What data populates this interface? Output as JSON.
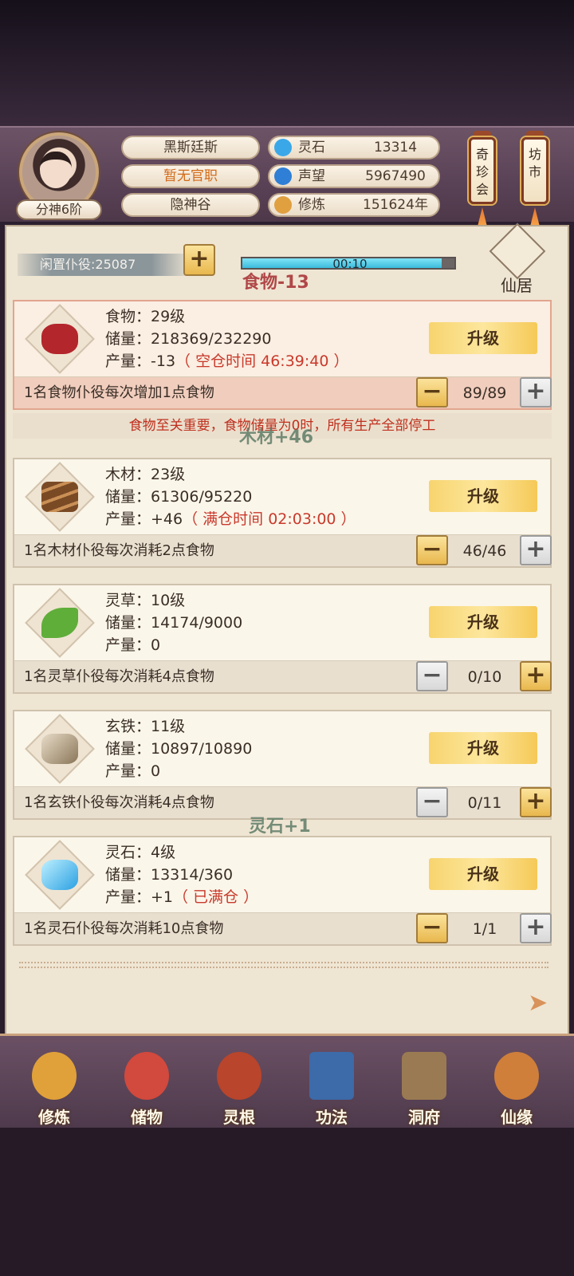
{
  "header": {
    "rank_badge": "分神6阶",
    "player_name": "黑斯廷斯",
    "official_title": "暂无官职",
    "location": "隐神谷",
    "resources": [
      {
        "label": "灵石",
        "value": "13314",
        "icon": "spirit-stone-icon",
        "color": "#3aa8e8"
      },
      {
        "label": "声望",
        "value": "5967490",
        "icon": "prestige-icon",
        "color": "#2f7fd6"
      },
      {
        "label": "修炼",
        "value": "151624年",
        "icon": "meditation-icon",
        "color": "#e0a040"
      }
    ],
    "shortcuts": [
      {
        "label_line1": "奇",
        "label_line2": "珍",
        "label_line3": "会"
      },
      {
        "label_line1": "坊",
        "label_line2": "市",
        "label_line3": ""
      }
    ]
  },
  "idle": {
    "label": "闲置仆役:25087",
    "timer": "00:10",
    "timer_progress": 0.94,
    "float_food": "食物-13",
    "float_wood": "木材+46",
    "float_stone": "灵石+1",
    "xianju_label": "仙居"
  },
  "resources": [
    {
      "name": "食物：29级",
      "storage": "储量：218369/232290",
      "output": "产量：-13",
      "output_note": "（ 空仓时间 46:39:40 ）",
      "upgrade": "升级",
      "desc": "1名食物仆役每次增加1点食物",
      "count": "89/89",
      "icon": "meat-icon",
      "minus_style": "gold",
      "plus_style": "grey"
    },
    {
      "name": "木材：23级",
      "storage": "储量：61306/95220",
      "output": "产量：+46",
      "output_note": "（ 满仓时间 02:03:00 ）",
      "upgrade": "升级",
      "desc": "1名木材仆役每次消耗2点食物",
      "count": "46/46",
      "icon": "wood-logs-icon",
      "minus_style": "gold",
      "plus_style": "grey"
    },
    {
      "name": "灵草：10级",
      "storage": "储量：14174/9000",
      "output": "产量：0",
      "output_note": "",
      "upgrade": "升级",
      "desc": "1名灵草仆役每次消耗4点食物",
      "count": "0/10",
      "icon": "herb-icon",
      "minus_style": "grey",
      "plus_style": "gold"
    },
    {
      "name": "玄铁：11级",
      "storage": "储量：10897/10890",
      "output": "产量：0",
      "output_note": "",
      "upgrade": "升级",
      "desc": "1名玄铁仆役每次消耗4点食物",
      "count": "0/11",
      "icon": "iron-ore-icon",
      "minus_style": "grey",
      "plus_style": "gold"
    },
    {
      "name": "灵石：4级",
      "storage": "储量：13314/360",
      "output": "产量：+1",
      "output_note": "（ 已满仓 ）",
      "upgrade": "升级",
      "desc": "1名灵石仆役每次消耗10点食物",
      "count": "1/1",
      "icon": "spirit-crystal-icon",
      "minus_style": "gold",
      "plus_style": "grey"
    }
  ],
  "warning": "食物至关重要，食物储量为0时，所有生产全部停工",
  "nav": [
    {
      "label": "修炼",
      "icon": "meditation-monk-icon",
      "color": "#e0a13a"
    },
    {
      "label": "储物",
      "icon": "storage-bag-icon",
      "color": "#d2493d"
    },
    {
      "label": "灵根",
      "icon": "spirit-root-icon",
      "color": "#b8452c"
    },
    {
      "label": "功法",
      "icon": "skill-book-icon",
      "color": "#3d6aa8"
    },
    {
      "label": "洞府",
      "icon": "cave-mansion-icon",
      "color": "#9a7a52"
    },
    {
      "label": "仙缘",
      "icon": "gourd-icon",
      "color": "#cf7f3a"
    }
  ]
}
